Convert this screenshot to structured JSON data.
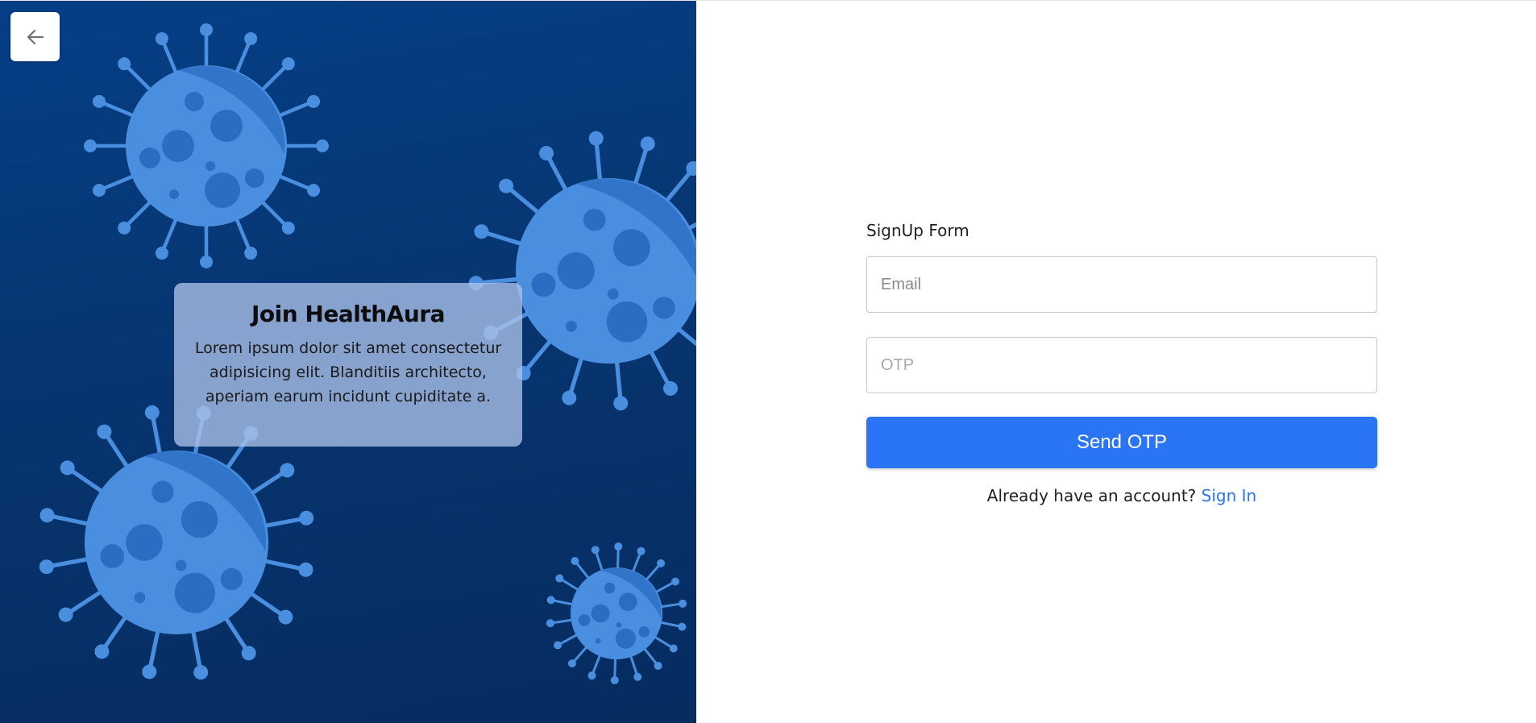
{
  "nav": {
    "back_icon": "arrow-left-icon"
  },
  "promo": {
    "title": "Join HealthAura",
    "text": "Lorem ipsum dolor sit amet consectetur adipisicing elit. Blanditiis architecto, aperiam earum incidunt cupiditate a."
  },
  "form": {
    "title": "SignUp Form",
    "email_placeholder": "Email",
    "otp_placeholder": "OTP",
    "submit_label": "Send OTP",
    "signin_prompt": "Already have an account?",
    "signin_link": "Sign In"
  },
  "colors": {
    "panel_bg": "#063f86",
    "virus_body": "#4a8fdf",
    "virus_spot": "#2a6ec4",
    "primary": "#2a75f5"
  },
  "illustration": {
    "virus_icon": "virus-icon"
  }
}
